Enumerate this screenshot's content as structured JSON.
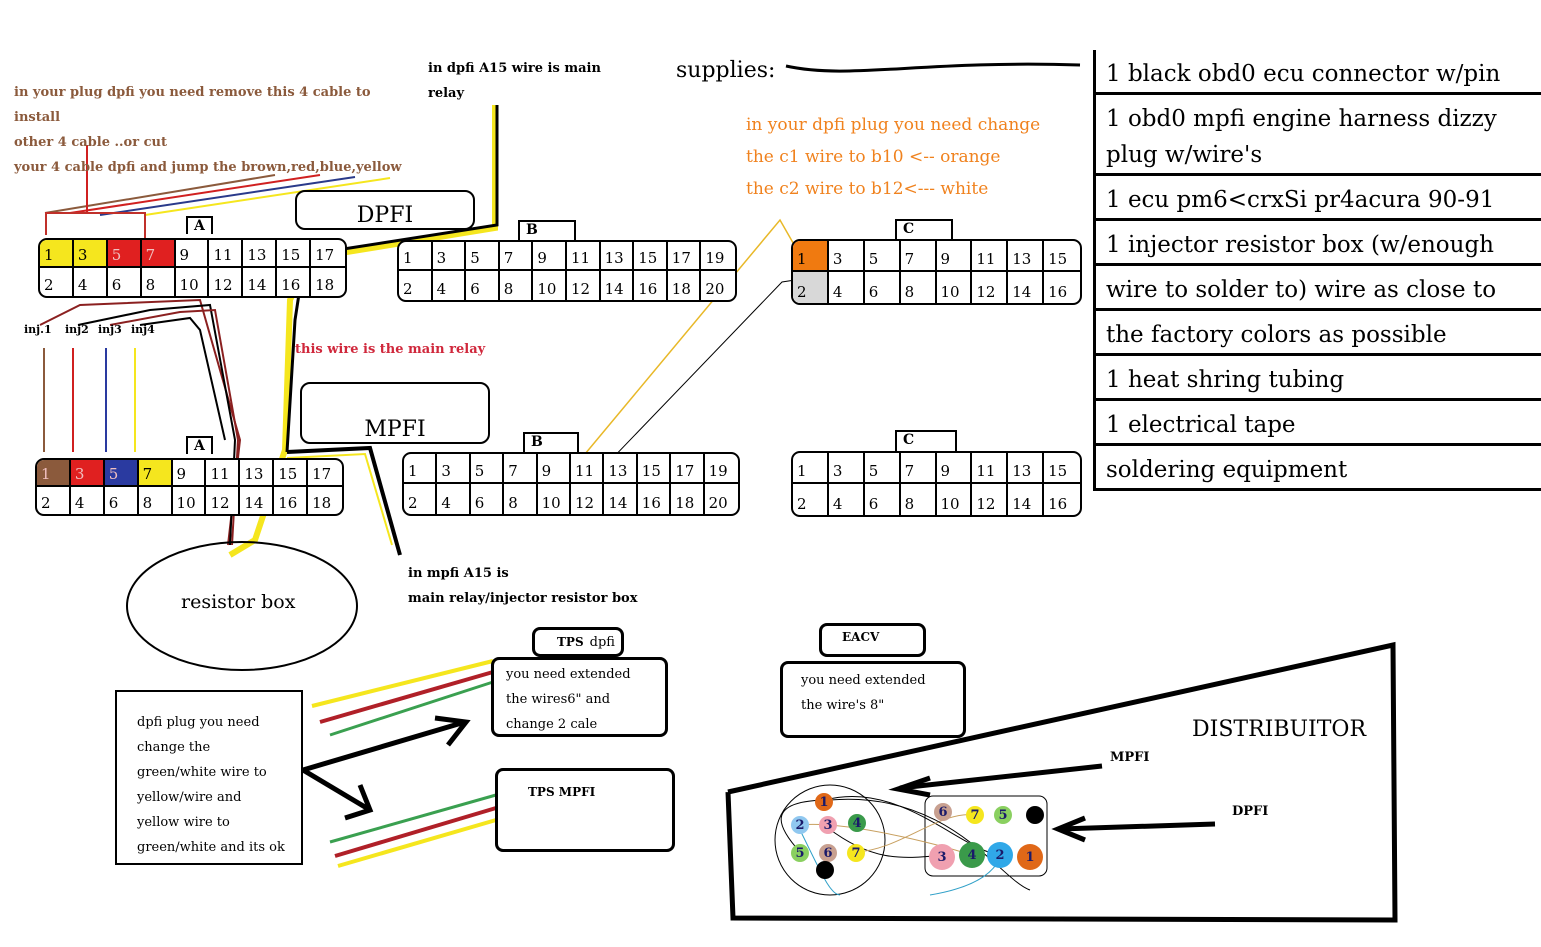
{
  "notes": {
    "remove_cable": [
      "in your plug dpfi you need remove this 4 cable to",
      "install",
      "other 4 cable ..or cut",
      "your 4 cable dpfi and jump the brown,red,blue,yellow"
    ],
    "dpfi_a15": [
      "in dpfi A15 wire is main",
      "relay"
    ],
    "change_c_wires": [
      "in your dpfi plug you need change",
      "the c1 wire to b10 <-- orange",
      "the c2 wire to b12<--- white"
    ],
    "main_relay": "this wire is the main relay",
    "mpfi_a15": [
      "in mpfi A15 is",
      "main relay/injector resistor box"
    ],
    "resistor_box": "resistor box",
    "dpfi_plug_note": [
      "dpfi plug you need",
      "change the",
      "green/white wire to",
      "yellow/wire and",
      "yellow wire to",
      "green/white and its ok"
    ],
    "tps_dpfi_note": [
      "you need extended",
      "the wires6\" and",
      "change 2 cale"
    ],
    "eacv_note": [
      "you need extended",
      "the wire's 8\""
    ]
  },
  "labels": {
    "dpfi_title": "DPFI",
    "mpfi_title": "MPFI",
    "tps_dpfi_tab": [
      "TPS",
      "dpfi"
    ],
    "tps_mpfi": "TPS MPFI",
    "eacv": "EACV",
    "distributor": "DISTRIBUITOR",
    "dist_mpfi": "MPFI",
    "dist_dpfi": "DPFI",
    "injectors": [
      "inj.1",
      "inj2",
      "inj3",
      "inj4"
    ]
  },
  "supplies": {
    "title": "supplies:",
    "items": [
      "1 black obd0 ecu connector w/pin",
      "1 obd0 mpfi engine harness dizzy",
      "plug w/wire's",
      "1 ecu pm6<crxSi pr4acura 90-91",
      "1 injector resistor box (w/enough",
      "wire to solder to) wire as close to",
      "the factory colors as possible",
      "1 heat shring tubing",
      "1 electrical tape",
      "soldering equipment"
    ]
  },
  "connectors": {
    "dpfi_a": {
      "tab": "A",
      "top": [
        "1",
        "3",
        "5",
        "7",
        "9",
        "11",
        "13",
        "15",
        "17"
      ],
      "bottom": [
        "2",
        "4",
        "6",
        "8",
        "10",
        "12",
        "14",
        "16",
        "18"
      ],
      "highlight": {
        "1": "#f5e61e",
        "3": "#f5e61e",
        "5": "#e02020",
        "7": "#e02020"
      }
    },
    "dpfi_b": {
      "tab": "B",
      "top": [
        "1",
        "3",
        "5",
        "7",
        "9",
        "11",
        "13",
        "15",
        "17",
        "19"
      ],
      "bottom": [
        "2",
        "4",
        "6",
        "8",
        "10",
        "12",
        "14",
        "16",
        "18",
        "20"
      ],
      "highlight": {}
    },
    "dpfi_c": {
      "tab": "C",
      "top": [
        "1",
        "3",
        "5",
        "7",
        "9",
        "11",
        "13",
        "15"
      ],
      "bottom": [
        "2",
        "4",
        "6",
        "8",
        "10",
        "12",
        "14",
        "16"
      ],
      "highlight": {
        "1": "#f07a10",
        "2": "#d8d8d8"
      }
    },
    "mpfi_a": {
      "tab": "A",
      "top": [
        "1",
        "3",
        "5",
        "7",
        "9",
        "11",
        "13",
        "15",
        "17"
      ],
      "bottom": [
        "2",
        "4",
        "6",
        "8",
        "10",
        "12",
        "14",
        "16",
        "18"
      ],
      "highlight": {
        "1": "#8b5a3c",
        "3": "#e02020",
        "5": "#2a3aa0",
        "7": "#f5e61e"
      }
    },
    "mpfi_b": {
      "tab": "B",
      "top": [
        "1",
        "3",
        "5",
        "7",
        "9",
        "11",
        "13",
        "15",
        "17",
        "19"
      ],
      "bottom": [
        "2",
        "4",
        "6",
        "8",
        "10",
        "12",
        "14",
        "16",
        "18",
        "20"
      ],
      "highlight": {}
    },
    "mpfi_c": {
      "tab": "C",
      "top": [
        "1",
        "3",
        "5",
        "7",
        "9",
        "11",
        "13",
        "15"
      ],
      "bottom": [
        "2",
        "4",
        "6",
        "8",
        "10",
        "12",
        "14",
        "16"
      ],
      "highlight": {}
    }
  },
  "distributor_pins": {
    "mpfi": [
      {
        "n": "1",
        "color": "#e06818"
      },
      {
        "n": "2",
        "color": "#90c8f0"
      },
      {
        "n": "3",
        "color": "#f0a0b0"
      },
      {
        "n": "4",
        "color": "#3a9a4a"
      },
      {
        "n": "5",
        "color": "#8ad060"
      },
      {
        "n": "6",
        "color": "#c8a090"
      },
      {
        "n": "7",
        "color": "#f5e61e"
      },
      {
        "n": "",
        "color": "#000000"
      }
    ],
    "dpfi": [
      {
        "n": "6",
        "color": "#c8a090"
      },
      {
        "n": "7",
        "color": "#f5e61e"
      },
      {
        "n": "5",
        "color": "#8ad060"
      },
      {
        "n": "",
        "color": "#000000"
      },
      {
        "n": "3",
        "color": "#f0a0b0"
      },
      {
        "n": "4",
        "color": "#3a9a4a"
      },
      {
        "n": "2",
        "color": "#30a8e8"
      },
      {
        "n": "1",
        "color": "#e06818"
      }
    ]
  }
}
